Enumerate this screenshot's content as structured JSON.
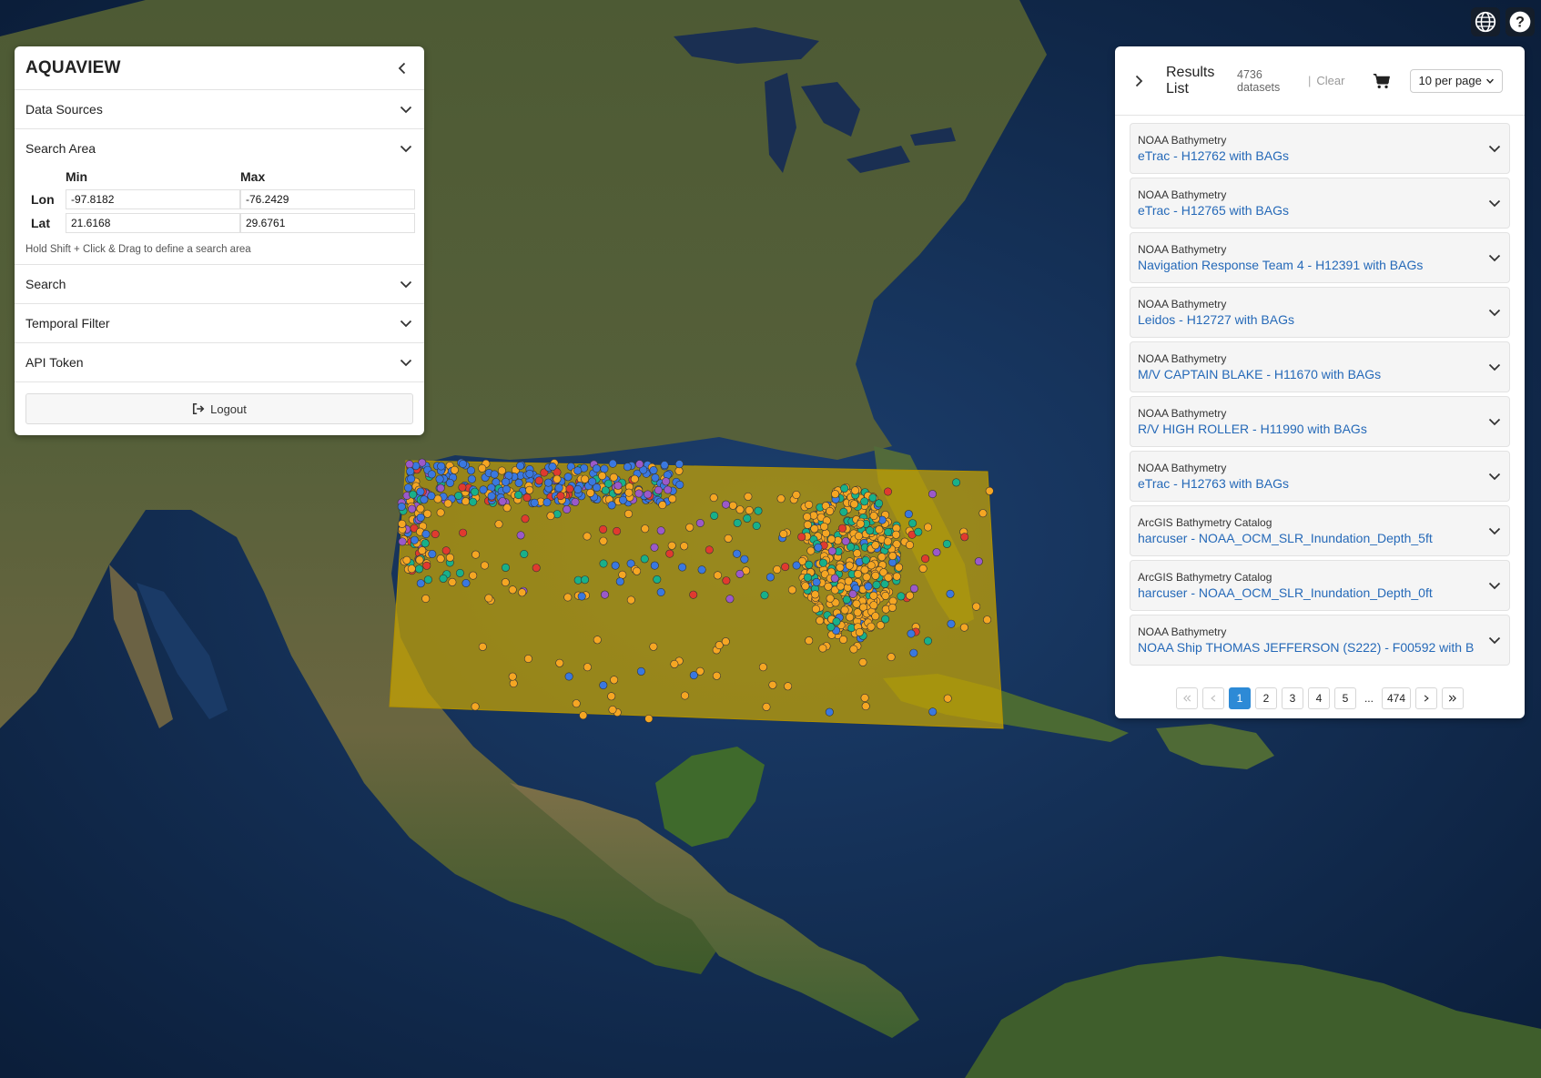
{
  "left_panel": {
    "title": "AQUAVIEW",
    "sections": {
      "data_sources": "Data Sources",
      "search_area": "Search Area",
      "search": "Search",
      "temporal_filter": "Temporal Filter",
      "api_token": "API Token"
    },
    "search_area": {
      "min_label": "Min",
      "max_label": "Max",
      "lon_label": "Lon",
      "lat_label": "Lat",
      "lon_min": "-97.8182",
      "lon_max": "-76.2429",
      "lat_min": "21.6168",
      "lat_max": "29.6761",
      "hint": "Hold Shift + Click & Drag to define a search area"
    },
    "logout_label": "Logout"
  },
  "results": {
    "title": "Results List",
    "count": "4736 datasets",
    "separator": "|",
    "clear_label": "Clear",
    "per_page": "10 per page",
    "items": [
      {
        "source": "NOAA Bathymetry",
        "title": "eTrac - H12762 with BAGs"
      },
      {
        "source": "NOAA Bathymetry",
        "title": "eTrac - H12765 with BAGs"
      },
      {
        "source": "NOAA Bathymetry",
        "title": "Navigation Response Team 4 - H12391 with BAGs"
      },
      {
        "source": "NOAA Bathymetry",
        "title": "Leidos - H12727 with BAGs"
      },
      {
        "source": "NOAA Bathymetry",
        "title": "M/V CAPTAIN BLAKE - H11670 with BAGs"
      },
      {
        "source": "NOAA Bathymetry",
        "title": "R/V HIGH ROLLER - H11990 with BAGs"
      },
      {
        "source": "NOAA Bathymetry",
        "title": "eTrac - H12763 with BAGs"
      },
      {
        "source": "ArcGIS Bathymetry Catalog",
        "title": "harcuser - NOAA_OCM_SLR_Inundation_Depth_5ft"
      },
      {
        "source": "ArcGIS Bathymetry Catalog",
        "title": "harcuser - NOAA_OCM_SLR_Inundation_Depth_0ft"
      },
      {
        "source": "NOAA Bathymetry",
        "title": "NOAA Ship THOMAS JEFFERSON (S222) - F00592 with B"
      }
    ],
    "pagination": {
      "pages": [
        "1",
        "2",
        "3",
        "4",
        "5"
      ],
      "ellipsis": "...",
      "last": "474",
      "current": "1"
    }
  },
  "icons": {
    "globe": "globe-icon",
    "help": "help-icon",
    "cart": "cart-icon",
    "logout": "logout-icon",
    "chevron": "chevron-down-icon"
  },
  "colors": {
    "accent": "#2d8ad6",
    "link": "#2569b8",
    "search_area_fill": "#c9a500",
    "marker_orange": "#f5a623",
    "marker_blue": "#3a78e0",
    "marker_teal": "#18b08a",
    "marker_red": "#e03a2f",
    "marker_purple": "#9b59c9"
  }
}
